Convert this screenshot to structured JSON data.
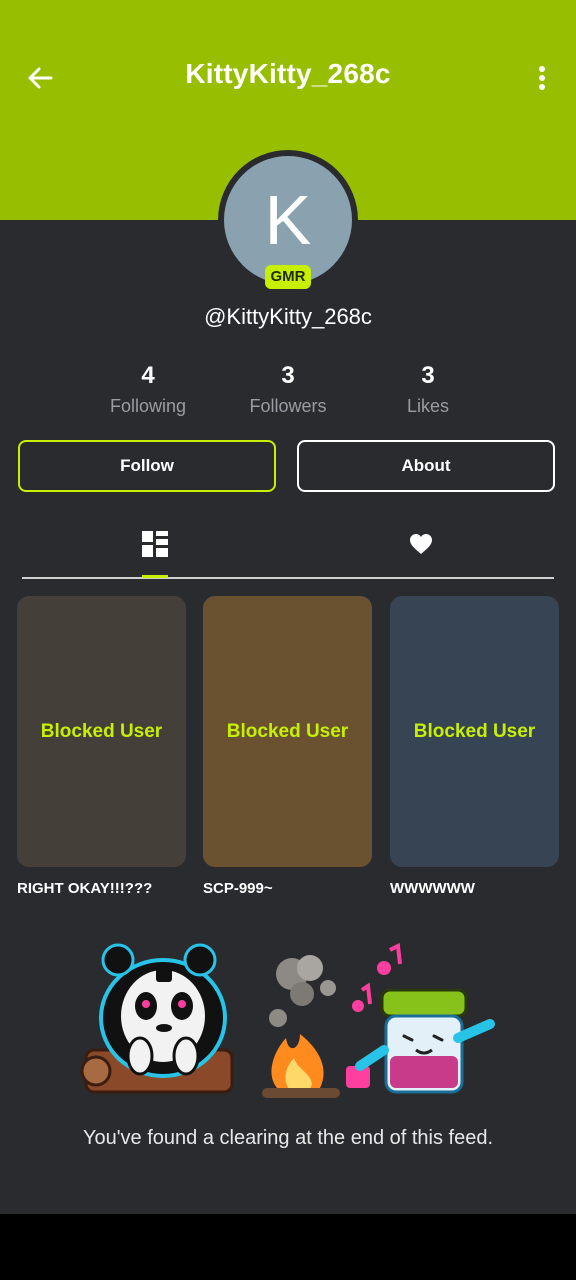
{
  "theme": {
    "accent": "#97bf00",
    "highlight": "#c6f000",
    "background": "#2a2b2f"
  },
  "header": {
    "title": "KittyKitty_268c",
    "back_icon": "arrow-left-icon",
    "menu_icon": "more-vertical-icon"
  },
  "profile": {
    "avatar_letter": "K",
    "badge": "GMR",
    "handle": "@KittyKitty_268c"
  },
  "stats": [
    {
      "value": "4",
      "label": "Following"
    },
    {
      "value": "3",
      "label": "Followers"
    },
    {
      "value": "3",
      "label": "Likes"
    }
  ],
  "actions": {
    "follow": "Follow",
    "about": "About"
  },
  "tabs": [
    {
      "icon": "grid-icon",
      "selected": true
    },
    {
      "icon": "heart-icon",
      "selected": false
    }
  ],
  "posts": [
    {
      "overlay": "Blocked User",
      "caption": "RIGHT OKAY!!!???",
      "color": "#453f3a"
    },
    {
      "overlay": "Blocked User",
      "caption": "SCP-999~",
      "color": "#6a5230"
    },
    {
      "overlay": "Blocked User",
      "caption": "WWWWWW",
      "color": "#364453"
    }
  ],
  "feed_end": {
    "message": "You've found a clearing at the end of this feed."
  }
}
